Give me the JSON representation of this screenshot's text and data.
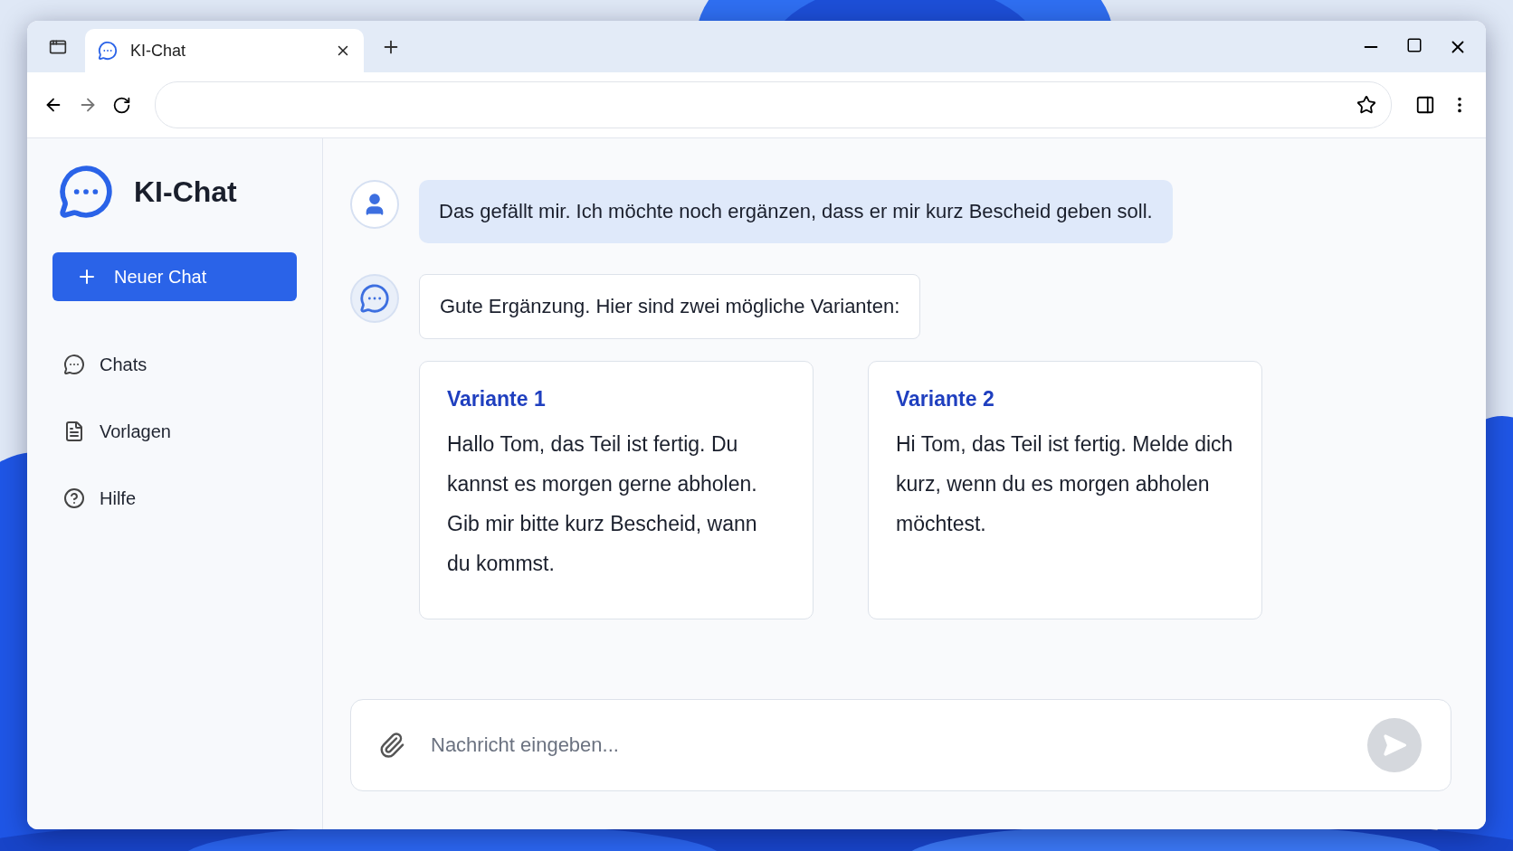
{
  "browser": {
    "tabs": [
      {
        "title": "KI-Chat",
        "selected": true
      }
    ]
  },
  "app": {
    "title": "KI-Chat",
    "new_chat_button": "Neuer Chat",
    "nav": [
      {
        "label": "Chats",
        "kind": "chats"
      },
      {
        "label": "Vorlagen",
        "kind": "templates"
      },
      {
        "label": "Hilfe",
        "kind": "help"
      }
    ]
  },
  "messages": [
    {
      "kind": "user",
      "text": "Das gefällt mir. Ich möchte noch ergänzen, dass er mir kurz Bescheid geben soll."
    },
    {
      "kind": "assistant",
      "text": "Gute Ergänzung. Hier sind zwei mögliche Varianten:",
      "variants": [
        {
          "title": "Variante 1",
          "text": "Hallo Tom, das Teil ist fertig. Du kannst es morgen gerne abholen. Gib mir bitte kurz Bescheid, wann du kommst."
        },
        {
          "title": "Variante 2",
          "text": "Hi Tom, das Teil ist fertig. Melde dich kurz, wenn du es morgen abholen möchtest."
        }
      ]
    }
  ],
  "composer": {
    "placeholder": "Nachricht eingeben..."
  }
}
